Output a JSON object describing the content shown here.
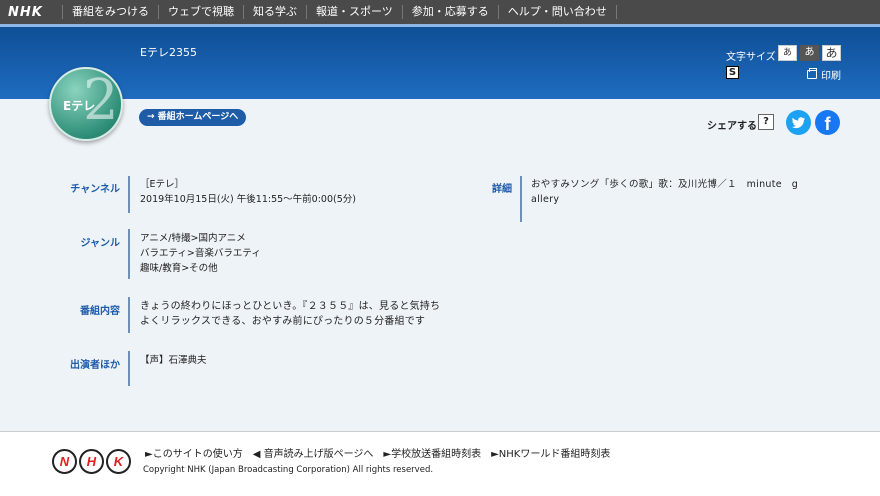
{
  "nav": {
    "logo": "NHK",
    "items": [
      "番組をみつける",
      "ウェブで視聴",
      "知る学ぶ",
      "報道・スポーツ",
      "参加・応募する",
      "ヘルプ・問い合わせ"
    ]
  },
  "header": {
    "program_title": "Eテレ2355",
    "font_size_label": "文字サイズ",
    "font_sizes": [
      "あ",
      "あ",
      "あ"
    ],
    "s_icon": "S",
    "print_label": "印刷"
  },
  "badge": {
    "channel": "Eテレ",
    "number": "2"
  },
  "home_button": "→ 番組ホームページへ",
  "share": {
    "label": "シェアする",
    "help": "?",
    "facebook": "f"
  },
  "info": {
    "channel": {
      "label": "チャンネル",
      "lines": [
        "［Eテレ］",
        "2019年10月15日(火) 午後11:55～午前0:00(5分)"
      ]
    },
    "detail": {
      "label": "詳細",
      "lines": [
        "おやすみソング「歩くの歌」歌：及川光博／１　minute　g",
        "allery"
      ]
    },
    "genre": {
      "label": "ジャンル",
      "lines": [
        "アニメ/特撮>国内アニメ",
        "バラエティ>音楽バラエティ",
        "趣味/教育>その他"
      ]
    },
    "content": {
      "label": "番組内容",
      "lines": [
        "きょうの終わりにほっとひといき。『２３５５』は、見ると気持ち",
        "よくリラックスできる、おやすみ前にぴったりの５分番組です"
      ]
    },
    "cast": {
      "label": "出演者ほか",
      "lines": [
        "【声】石澤典夫"
      ]
    }
  },
  "footer": {
    "logo_letters": [
      "N",
      "H",
      "K"
    ],
    "links": [
      "►このサイトの使い方",
      "◀ 音声読み上げ版ページへ",
      "►学校放送番組時刻表",
      "►NHKワールド番組時刻表"
    ],
    "copyright": "Copyright NHK (Japan Broadcasting Corporation) All rights reserved."
  }
}
